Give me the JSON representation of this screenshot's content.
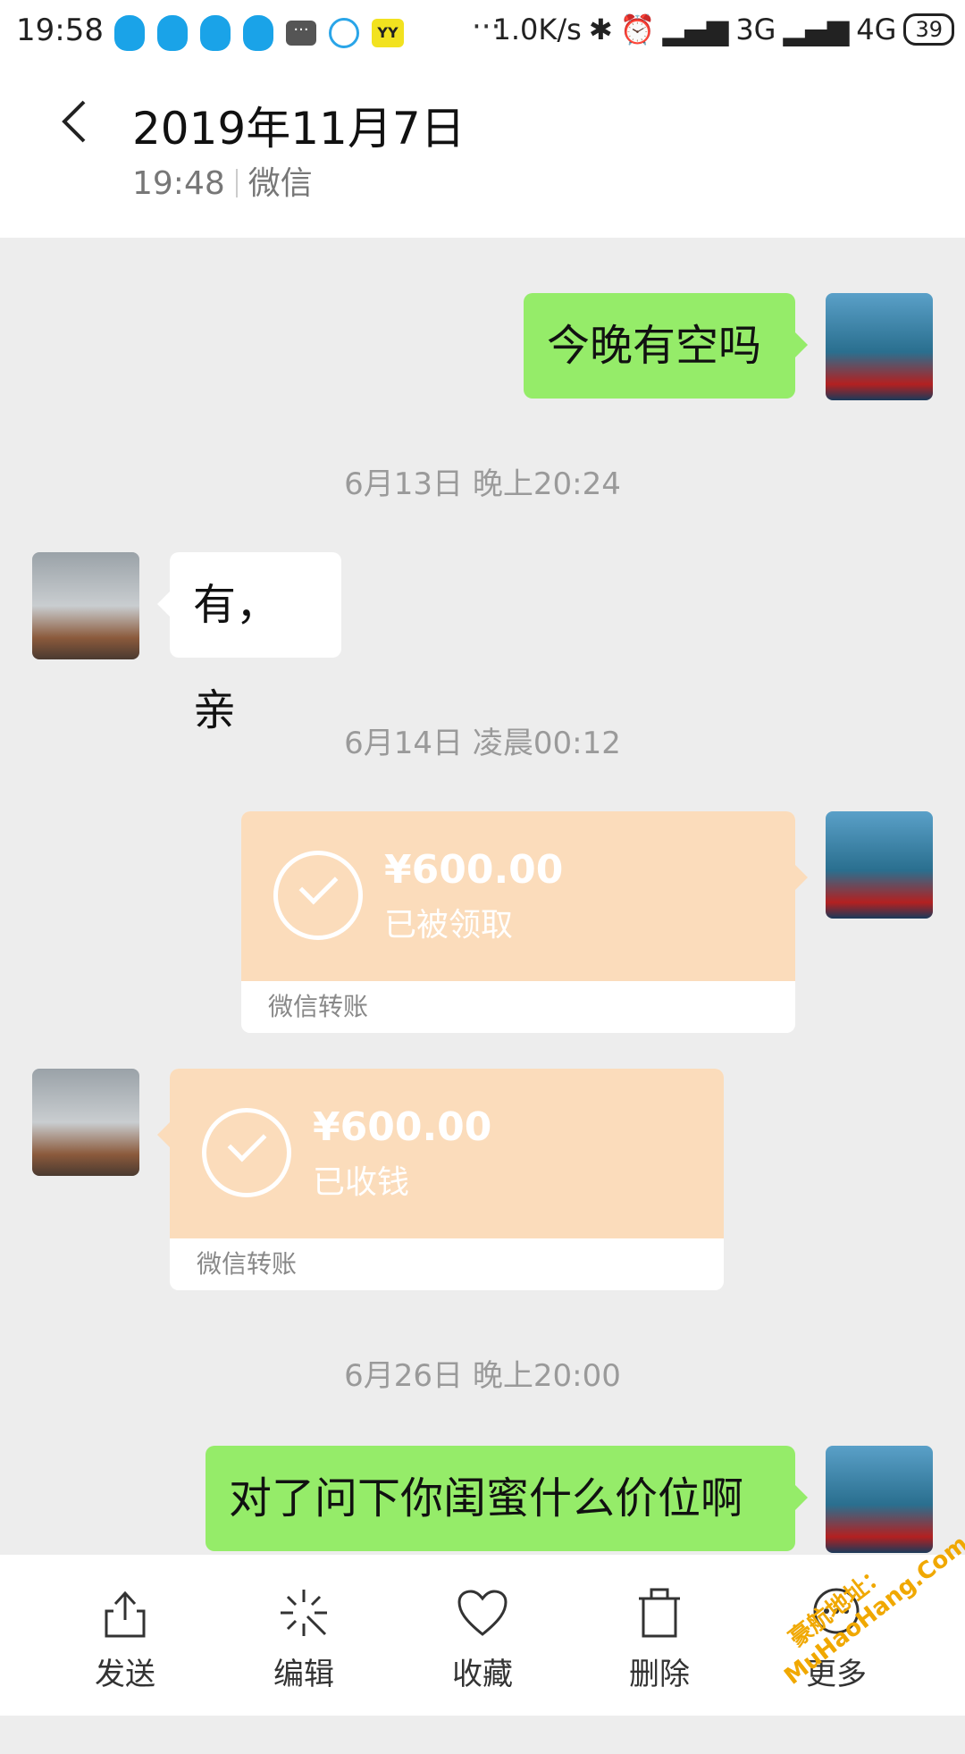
{
  "status_bar": {
    "time": "19:58",
    "dots": "···",
    "speed": "1.0K/s",
    "network_3g": "3G",
    "network_4g": "4G",
    "battery": "39",
    "icons": [
      "qq-icon",
      "qq-icon",
      "qq-icon",
      "qq-icon",
      "message-icon",
      "qq-download-icon",
      "yy-icon",
      "bluetooth-icon",
      "alarm-icon",
      "signal-icon"
    ],
    "yy_label": "YY"
  },
  "header": {
    "title": "2019年11月7日",
    "time": "19:48",
    "source": "微信"
  },
  "messages": {
    "m1": {
      "text": "今晚有空吗",
      "side": "right"
    },
    "ts1": "6月13日 晚上20:24",
    "m2": {
      "text": "有，亲",
      "side": "left"
    },
    "ts2": "6月14日 凌晨00:12",
    "t1": {
      "amount": "¥600.00",
      "status": "已被领取",
      "label": "微信转账",
      "side": "right"
    },
    "t2": {
      "amount": "¥600.00",
      "status": "已收钱",
      "label": "微信转账",
      "side": "left"
    },
    "ts3": "6月26日 晚上20:00",
    "m3": {
      "text": "对了问下你闺蜜什么价位啊",
      "side": "right"
    }
  },
  "toolbar": {
    "send": "发送",
    "edit": "编辑",
    "favorite": "收藏",
    "delete": "删除",
    "more": "更多"
  },
  "watermark": {
    "line1": "豪航地址：",
    "line2": "MuHaoHang.Com"
  },
  "colors": {
    "green_bubble": "#95ec69",
    "transfer": "#fbdcbb",
    "background": "#ededed"
  }
}
